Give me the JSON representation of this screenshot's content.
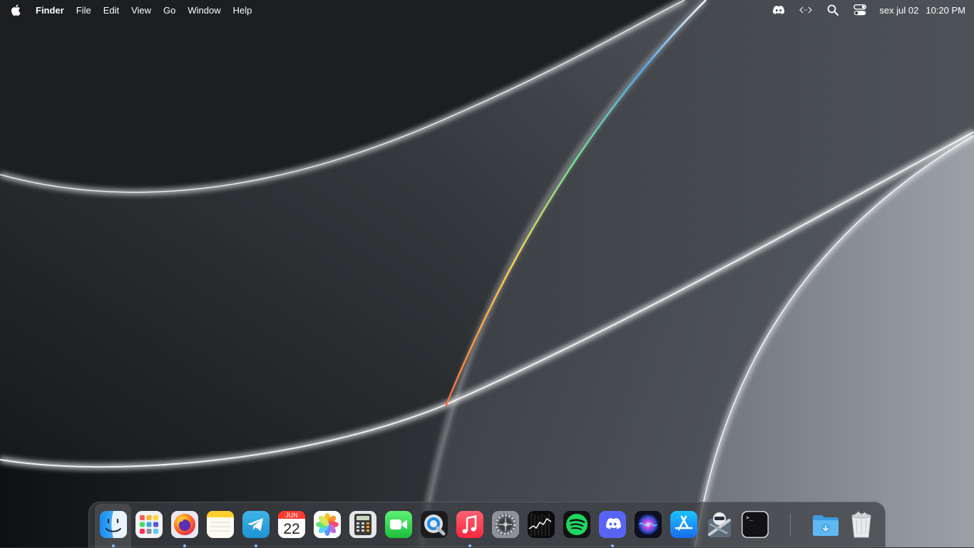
{
  "menubar": {
    "app_name": "Finder",
    "menus": [
      "File",
      "Edit",
      "View",
      "Go",
      "Window",
      "Help"
    ],
    "status": {
      "date": "sex jul 02",
      "time": "10:20 PM"
    }
  },
  "dock": {
    "apps": [
      {
        "id": "finder",
        "icon": "finder-icon",
        "running": true
      },
      {
        "id": "launchpad",
        "icon": "launchpad-icon",
        "running": false
      },
      {
        "id": "firefox",
        "icon": "firefox-icon",
        "running": true
      },
      {
        "id": "notes",
        "icon": "notes-icon",
        "running": false
      },
      {
        "id": "telegram",
        "icon": "telegram-icon",
        "running": true
      },
      {
        "id": "calendar",
        "icon": "calendar-icon",
        "running": false
      },
      {
        "id": "photos",
        "icon": "photos-icon",
        "running": false
      },
      {
        "id": "calculator",
        "icon": "calculator-icon",
        "running": false
      },
      {
        "id": "facetime",
        "icon": "facetime-icon",
        "running": false
      },
      {
        "id": "quicktime",
        "icon": "quicktime-icon",
        "running": false
      },
      {
        "id": "music",
        "icon": "music-icon",
        "running": true
      },
      {
        "id": "system-preferences",
        "icon": "gear-icon",
        "running": false
      },
      {
        "id": "stocks",
        "icon": "stocks-icon",
        "running": false
      },
      {
        "id": "spotify",
        "icon": "spotify-icon",
        "running": false
      },
      {
        "id": "discord",
        "icon": "discord-icon",
        "running": true
      },
      {
        "id": "siri",
        "icon": "siri-icon",
        "running": false
      },
      {
        "id": "app-store",
        "icon": "app-store-icon",
        "running": false
      },
      {
        "id": "automator",
        "icon": "automator-icon",
        "running": false
      },
      {
        "id": "terminal",
        "icon": "terminal-icon",
        "running": false
      }
    ],
    "calendar": {
      "month": "JUN",
      "day": "22"
    },
    "terminal_prompt": ">_",
    "trailing": [
      {
        "id": "downloads",
        "icon": "downloads-folder-icon"
      },
      {
        "id": "trash",
        "icon": "trash-icon"
      }
    ]
  },
  "colors": {
    "menubar_text": "#ffffff",
    "dock_background": "#3c3e42",
    "running_dot": "#8fb8ff",
    "wallpaper_dark": "#101214",
    "wallpaper_light": "#8a9096"
  }
}
